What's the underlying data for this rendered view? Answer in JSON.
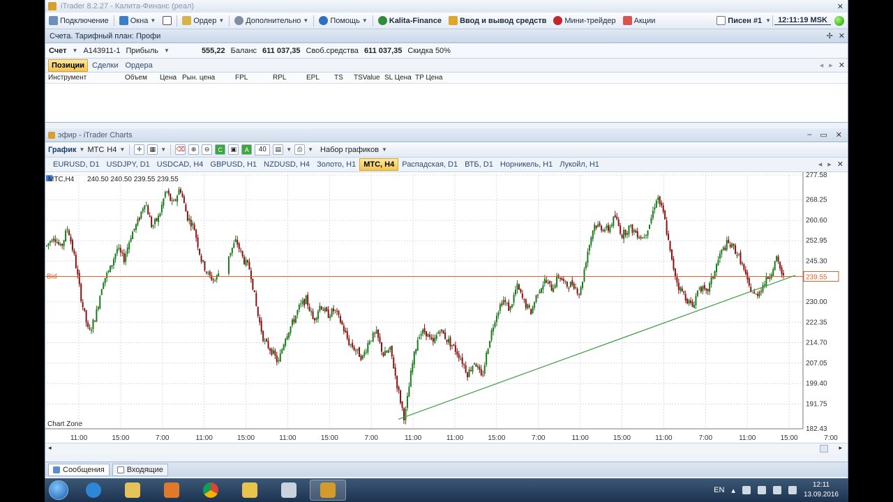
{
  "window": {
    "title": "iTrader 8.2.27 - Калита-Финанс (реал)"
  },
  "menu": {
    "items": [
      {
        "label": "Подключение",
        "bold": false
      },
      {
        "label": "Окна",
        "bold": false
      },
      {
        "label": "Ордер",
        "bold": false
      },
      {
        "label": "Дополнительно",
        "bold": false
      },
      {
        "label": "Помощь",
        "bold": false
      },
      {
        "label": "Kalita-Finance",
        "bold": true
      },
      {
        "label": "Ввод и вывод средств",
        "bold": true
      },
      {
        "label": "Мини-трейдер",
        "bold": false
      },
      {
        "label": "Акции",
        "bold": false
      }
    ],
    "user": "Писен #1",
    "clock": "12:11:19 MSK"
  },
  "account_panel": {
    "title": "Счета. Тарифный план: Профи",
    "account_label": "Счет",
    "account_id": "A143911-1",
    "profit_label": "Прибыль",
    "profit_value": "555,22",
    "balance_label": "Баланс",
    "balance_value": "611 037,35",
    "free_label": "Своб.средства",
    "free_value": "611 037,35",
    "discount": "Скидка 50%"
  },
  "positions": {
    "tabs": [
      "Позиции",
      "Сделки",
      "Ордера"
    ],
    "active_tab": 0,
    "columns": [
      "Инструмент",
      "Объем",
      "Цена",
      "Рын. цена",
      "FPL",
      "RPL",
      "EPL",
      "TS",
      "TSValue",
      "SL Цена",
      "TP Цена"
    ]
  },
  "chart_window": {
    "title": "эфир - iTrader Charts",
    "toolbar": {
      "chart_label": "График",
      "symbol": "МТС",
      "timeframe": "H4",
      "count": "40",
      "sets_label": "Набор графиков"
    },
    "tabs": [
      "EURUSD, D1",
      "USDJPY, D1",
      "USDCAD, H4",
      "GBPUSD, H1",
      "NZDUSD, H4",
      "Золото, H1",
      "МТС, H4",
      "Распадская, D1",
      "ВТБ, D1",
      "Норникель, H1",
      "Лукойл, H1"
    ],
    "active_tab": 6,
    "ohlc_label": "МТС,H4",
    "ohlc_values": "240.50  240.50  239.55  239.55",
    "bid_label": "Bid",
    "bid_price": "239.55",
    "zone_label": "Chart Zone"
  },
  "chart_data": {
    "type": "candlestick",
    "symbol": "МТС",
    "timeframe": "H4",
    "y_ticks": [
      "277.58",
      "268.25",
      "260.60",
      "252.95",
      "245.30",
      "239.55",
      "230.00",
      "222.35",
      "214.70",
      "207.05",
      "199.40",
      "191.75",
      "182.43"
    ],
    "x_ticks": [
      "11:00",
      "15:00",
      "7:00",
      "11:00",
      "15:00",
      "11:00",
      "15:00",
      "7:00",
      "11:00",
      "11:00",
      "15:00",
      "7:00",
      "11:00",
      "15:00",
      "11:00",
      "7:00",
      "11:00",
      "15:00",
      "7:00"
    ],
    "ylim": [
      182.43,
      277.58
    ],
    "bid": 239.55,
    "price_path": [
      [
        0,
        251
      ],
      [
        1,
        255
      ],
      [
        2,
        250
      ],
      [
        3,
        258
      ],
      [
        4,
        246
      ],
      [
        5,
        230
      ],
      [
        6,
        218
      ],
      [
        7,
        225
      ],
      [
        8,
        238
      ],
      [
        9,
        242
      ],
      [
        10,
        250
      ],
      [
        11,
        246
      ],
      [
        12,
        255
      ],
      [
        13,
        260
      ],
      [
        14,
        268
      ],
      [
        15,
        258
      ],
      [
        16,
        262
      ],
      [
        17,
        272
      ],
      [
        18,
        266
      ],
      [
        19,
        273
      ],
      [
        20,
        262
      ],
      [
        21,
        258
      ],
      [
        22,
        246
      ],
      [
        23,
        240
      ],
      [
        24,
        238
      ],
      [
        25,
        244
      ],
      [
        26,
        248
      ],
      [
        27,
        253
      ],
      [
        28,
        246
      ],
      [
        29,
        242
      ],
      [
        30,
        226
      ],
      [
        31,
        215
      ],
      [
        32,
        212
      ],
      [
        33,
        207
      ],
      [
        34,
        217
      ],
      [
        35,
        222
      ],
      [
        36,
        228
      ],
      [
        37,
        231
      ],
      [
        38,
        223
      ],
      [
        39,
        229
      ],
      [
        40,
        225
      ],
      [
        41,
        227
      ],
      [
        42,
        222
      ],
      [
        43,
        215
      ],
      [
        44,
        212
      ],
      [
        45,
        209
      ],
      [
        46,
        216
      ],
      [
        47,
        218
      ],
      [
        48,
        210
      ],
      [
        49,
        212
      ],
      [
        50,
        198
      ],
      [
        51,
        186
      ],
      [
        52,
        205
      ],
      [
        53,
        218
      ],
      [
        54,
        219
      ],
      [
        55,
        214
      ],
      [
        56,
        220
      ],
      [
        57,
        216
      ],
      [
        58,
        213
      ],
      [
        59,
        209
      ],
      [
        60,
        203
      ],
      [
        61,
        208
      ],
      [
        62,
        201
      ],
      [
        63,
        215
      ],
      [
        64,
        225
      ],
      [
        65,
        231
      ],
      [
        66,
        227
      ],
      [
        67,
        236
      ],
      [
        68,
        230
      ],
      [
        69,
        226
      ],
      [
        70,
        234
      ],
      [
        71,
        238
      ],
      [
        72,
        235
      ],
      [
        73,
        240
      ],
      [
        74,
        236
      ],
      [
        75,
        237
      ],
      [
        76,
        233
      ],
      [
        77,
        248
      ],
      [
        78,
        259
      ],
      [
        79,
        258
      ],
      [
        80,
        257
      ],
      [
        81,
        262
      ],
      [
        82,
        255
      ],
      [
        83,
        258
      ],
      [
        84,
        256
      ],
      [
        85,
        254
      ],
      [
        86,
        260
      ],
      [
        87,
        270
      ],
      [
        88,
        262
      ],
      [
        89,
        246
      ],
      [
        90,
        236
      ],
      [
        91,
        232
      ],
      [
        92,
        228
      ],
      [
        93,
        236
      ],
      [
        94,
        233
      ],
      [
        95,
        240
      ],
      [
        96,
        248
      ],
      [
        97,
        252
      ],
      [
        98,
        250
      ],
      [
        99,
        245
      ],
      [
        100,
        236
      ],
      [
        101,
        232
      ],
      [
        102,
        236
      ],
      [
        103,
        240
      ],
      [
        104,
        246
      ],
      [
        105,
        239
      ]
    ],
    "trendline": {
      "from": [
        0.465,
        186
      ],
      "to": [
        0.99,
        240
      ]
    }
  },
  "bottom_tabs": [
    "Сообщения",
    "Входящие"
  ],
  "taskbar": {
    "lang": "EN",
    "time": "12:11",
    "date": "13.09.2016"
  }
}
